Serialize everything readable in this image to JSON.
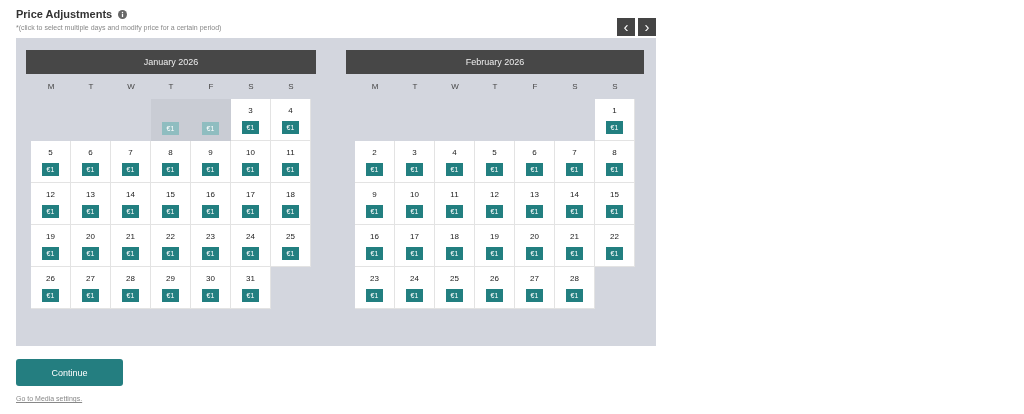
{
  "title": "Price Adjustments",
  "hint": "*(click to select multiple days and modify price for a certain period)",
  "nav": [
    "‹",
    "›"
  ],
  "months": [
    {
      "name": "January 2026",
      "weekdays": [
        "M",
        "T",
        "W",
        "T",
        "F",
        "S",
        "S"
      ],
      "cells": [
        {
          "kind": "empty"
        },
        {
          "kind": "empty"
        },
        {
          "kind": "empty"
        },
        {
          "kind": "day",
          "disabled": true,
          "price": "€1"
        },
        {
          "kind": "day",
          "disabled": true,
          "price": "€1"
        },
        {
          "kind": "day",
          "disabled": false,
          "day": "3",
          "price": "€1"
        },
        {
          "kind": "day",
          "disabled": false,
          "day": "4",
          "price": "€1"
        },
        {
          "kind": "day",
          "disabled": false,
          "day": "5",
          "price": "€1"
        },
        {
          "kind": "day",
          "disabled": false,
          "day": "6",
          "price": "€1"
        },
        {
          "kind": "day",
          "disabled": false,
          "day": "7",
          "price": "€1"
        },
        {
          "kind": "day",
          "disabled": false,
          "day": "8",
          "price": "€1"
        },
        {
          "kind": "day",
          "disabled": false,
          "day": "9",
          "price": "€1"
        },
        {
          "kind": "day",
          "disabled": false,
          "day": "10",
          "price": "€1"
        },
        {
          "kind": "day",
          "disabled": false,
          "day": "11",
          "price": "€1"
        },
        {
          "kind": "day",
          "disabled": false,
          "day": "12",
          "price": "€1"
        },
        {
          "kind": "day",
          "disabled": false,
          "day": "13",
          "price": "€1"
        },
        {
          "kind": "day",
          "disabled": false,
          "day": "14",
          "price": "€1"
        },
        {
          "kind": "day",
          "disabled": false,
          "day": "15",
          "price": "€1"
        },
        {
          "kind": "day",
          "disabled": false,
          "day": "16",
          "price": "€1"
        },
        {
          "kind": "day",
          "disabled": false,
          "day": "17",
          "price": "€1"
        },
        {
          "kind": "day",
          "disabled": false,
          "day": "18",
          "price": "€1"
        },
        {
          "kind": "day",
          "disabled": false,
          "day": "19",
          "price": "€1"
        },
        {
          "kind": "day",
          "disabled": false,
          "day": "20",
          "price": "€1"
        },
        {
          "kind": "day",
          "disabled": false,
          "day": "21",
          "price": "€1"
        },
        {
          "kind": "day",
          "disabled": false,
          "day": "22",
          "price": "€1"
        },
        {
          "kind": "day",
          "disabled": false,
          "day": "23",
          "price": "€1"
        },
        {
          "kind": "day",
          "disabled": false,
          "day": "24",
          "price": "€1"
        },
        {
          "kind": "day",
          "disabled": false,
          "day": "25",
          "price": "€1"
        },
        {
          "kind": "day",
          "disabled": false,
          "day": "26",
          "price": "€1"
        },
        {
          "kind": "day",
          "disabled": false,
          "day": "27",
          "price": "€1"
        },
        {
          "kind": "day",
          "disabled": false,
          "day": "28",
          "price": "€1"
        },
        {
          "kind": "day",
          "disabled": false,
          "day": "29",
          "price": "€1"
        },
        {
          "kind": "day",
          "disabled": false,
          "day": "30",
          "price": "€1"
        },
        {
          "kind": "day",
          "disabled": false,
          "day": "31",
          "price": "€1"
        }
      ]
    },
    {
      "name": "February 2026",
      "weekdays": [
        "M",
        "T",
        "W",
        "T",
        "F",
        "S",
        "S"
      ],
      "cells": [
        {
          "kind": "empty"
        },
        {
          "kind": "empty"
        },
        {
          "kind": "empty"
        },
        {
          "kind": "empty"
        },
        {
          "kind": "empty"
        },
        {
          "kind": "empty"
        },
        {
          "kind": "day",
          "disabled": false,
          "day": "1",
          "price": "€1"
        },
        {
          "kind": "day",
          "disabled": false,
          "day": "2",
          "price": "€1"
        },
        {
          "kind": "day",
          "disabled": false,
          "day": "3",
          "price": "€1"
        },
        {
          "kind": "day",
          "disabled": false,
          "day": "4",
          "price": "€1"
        },
        {
          "kind": "day",
          "disabled": false,
          "day": "5",
          "price": "€1"
        },
        {
          "kind": "day",
          "disabled": false,
          "day": "6",
          "price": "€1"
        },
        {
          "kind": "day",
          "disabled": false,
          "day": "7",
          "price": "€1"
        },
        {
          "kind": "day",
          "disabled": false,
          "day": "8",
          "price": "€1"
        },
        {
          "kind": "day",
          "disabled": false,
          "day": "9",
          "price": "€1"
        },
        {
          "kind": "day",
          "disabled": false,
          "day": "10",
          "price": "€1"
        },
        {
          "kind": "day",
          "disabled": false,
          "day": "11",
          "price": "€1"
        },
        {
          "kind": "day",
          "disabled": false,
          "day": "12",
          "price": "€1"
        },
        {
          "kind": "day",
          "disabled": false,
          "day": "13",
          "price": "€1"
        },
        {
          "kind": "day",
          "disabled": false,
          "day": "14",
          "price": "€1"
        },
        {
          "kind": "day",
          "disabled": false,
          "day": "15",
          "price": "€1"
        },
        {
          "kind": "day",
          "disabled": false,
          "day": "16",
          "price": "€1"
        },
        {
          "kind": "day",
          "disabled": false,
          "day": "17",
          "price": "€1"
        },
        {
          "kind": "day",
          "disabled": false,
          "day": "18",
          "price": "€1"
        },
        {
          "kind": "day",
          "disabled": false,
          "day": "19",
          "price": "€1"
        },
        {
          "kind": "day",
          "disabled": false,
          "day": "20",
          "price": "€1"
        },
        {
          "kind": "day",
          "disabled": false,
          "day": "21",
          "price": "€1"
        },
        {
          "kind": "day",
          "disabled": false,
          "day": "22",
          "price": "€1"
        },
        {
          "kind": "day",
          "disabled": false,
          "day": "23",
          "price": "€1"
        },
        {
          "kind": "day",
          "disabled": false,
          "day": "24",
          "price": "€1"
        },
        {
          "kind": "day",
          "disabled": false,
          "day": "25",
          "price": "€1"
        },
        {
          "kind": "day",
          "disabled": false,
          "day": "26",
          "price": "€1"
        },
        {
          "kind": "day",
          "disabled": false,
          "day": "27",
          "price": "€1"
        },
        {
          "kind": "day",
          "disabled": false,
          "day": "28",
          "price": "€1"
        }
      ]
    }
  ],
  "continue": "Continue",
  "link": "Go to Media settings."
}
